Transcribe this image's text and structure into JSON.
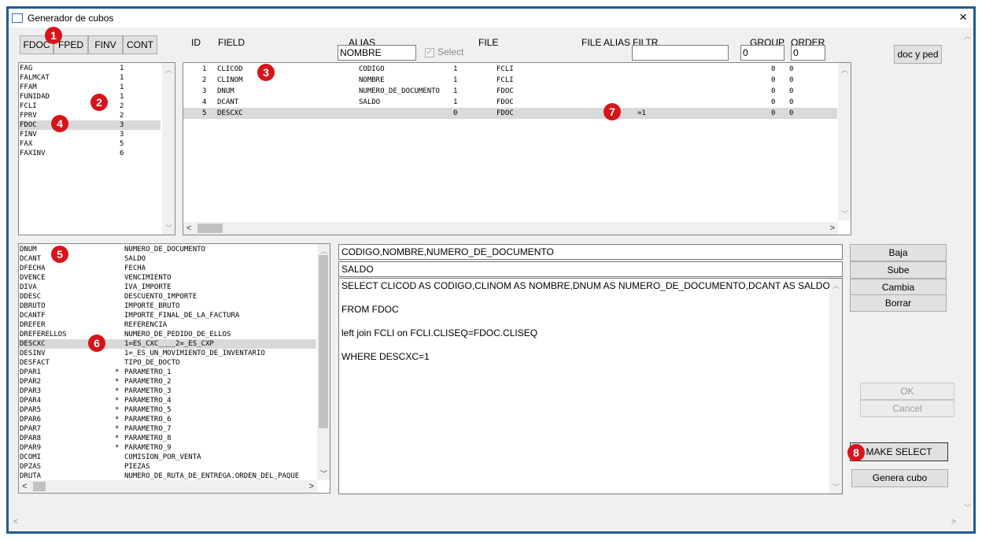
{
  "window": {
    "title": "Generador de cubos",
    "close_icon": "×"
  },
  "tabs": [
    "FDOC",
    "FPED",
    "FINV",
    "CONT"
  ],
  "headers": {
    "id": "ID",
    "field": "FIELD",
    "alias": "ALIAS",
    "file": "FILE",
    "file_alias": "FILE ALIAS",
    "filtr": "FILTR",
    "group": "GROUP",
    "order": "ORDER",
    "select_label": "Select"
  },
  "inputs": {
    "alias": "NOMBRE",
    "filtr": "",
    "group": "0",
    "order": "0"
  },
  "doc_y_ped_label": "doc y ped",
  "files_list": [
    {
      "name": "FAG",
      "count": "1"
    },
    {
      "name": "FALMCAT",
      "count": "1"
    },
    {
      "name": "FFAM",
      "count": "1"
    },
    {
      "name": "FUNIDAD",
      "count": "1"
    },
    {
      "name": "FCLI",
      "count": "2"
    },
    {
      "name": "FPRV",
      "count": "2"
    },
    {
      "name": "FDOC",
      "count": "3"
    },
    {
      "name": "FINV",
      "count": "3"
    },
    {
      "name": "FAX",
      "count": "5"
    },
    {
      "name": "FAXINV",
      "count": "6"
    }
  ],
  "grid_rows": [
    {
      "id": "1",
      "field": "CLICOD",
      "alias": "CODIGO",
      "n": "1",
      "file": "FCLI",
      "filtr": "",
      "group": "0",
      "order": "0"
    },
    {
      "id": "2",
      "field": "CLINOM",
      "alias": "NOMBRE",
      "n": "1",
      "file": "FCLI",
      "filtr": "",
      "group": "0",
      "order": "0"
    },
    {
      "id": "3",
      "field": "DNUM",
      "alias": "NUMERO_DE_DOCUMENTO",
      "n": "1",
      "file": "FDOC",
      "filtr": "",
      "group": "0",
      "order": "0"
    },
    {
      "id": "4",
      "field": "DCANT",
      "alias": "SALDO",
      "n": "1",
      "file": "FDOC",
      "filtr": "",
      "group": "0",
      "order": "0"
    },
    {
      "id": "5",
      "field": "DESCXC",
      "alias": "",
      "n": "0",
      "file": "FDOC",
      "filtr": "=1",
      "group": "0",
      "order": "0"
    }
  ],
  "fields_list": [
    {
      "name": "DNUM",
      "star": "",
      "desc": "NUMERO_DE_DOCUMENTO"
    },
    {
      "name": "DCANT",
      "star": "",
      "desc": "SALDO"
    },
    {
      "name": "DFECHA",
      "star": "",
      "desc": "FECHA"
    },
    {
      "name": "DVENCE",
      "star": "",
      "desc": "VENCIMIENTO"
    },
    {
      "name": "DIVA",
      "star": "",
      "desc": "IVA_IMPORTE"
    },
    {
      "name": "DDESC",
      "star": "",
      "desc": "DESCUENTO_IMPORTE"
    },
    {
      "name": "DBRUTO",
      "star": "",
      "desc": "IMPORTE_BRUTO"
    },
    {
      "name": "DCANTF",
      "star": "",
      "desc": "IMPORTE_FINAL_DE_LA_FACTURA"
    },
    {
      "name": "DREFER",
      "star": "",
      "desc": "REFERENCIA"
    },
    {
      "name": "DREFERELLOS",
      "star": "",
      "desc": "NUMERO_DE_PEDIDO_DE_ELLOS"
    },
    {
      "name": "DESCXC",
      "star": "",
      "desc": "1=ES_CXC____2=_ES_CXP"
    },
    {
      "name": "DESINV",
      "star": "",
      "desc": "1=_ES_UN_MOVIMIENTO_DE_INVENTARIO"
    },
    {
      "name": "DESFACT",
      "star": "",
      "desc": "TIPO_DE_DOCTO"
    },
    {
      "name": "DPAR1",
      "star": "*",
      "desc": "PARAMETRO_1"
    },
    {
      "name": "DPAR2",
      "star": "*",
      "desc": "PARAMETRO_2"
    },
    {
      "name": "DPAR3",
      "star": "*",
      "desc": "PARAMETRO_3"
    },
    {
      "name": "DPAR4",
      "star": "*",
      "desc": "PARAMETRO_4"
    },
    {
      "name": "DPAR5",
      "star": "*",
      "desc": "PARAMETRO_5"
    },
    {
      "name": "DPAR6",
      "star": "*",
      "desc": "PARAMETRO_6"
    },
    {
      "name": "DPAR7",
      "star": "*",
      "desc": "PARAMETRO_7"
    },
    {
      "name": "DPAR8",
      "star": "*",
      "desc": "PARAMETRO_8"
    },
    {
      "name": "DPAR9",
      "star": "*",
      "desc": "PARAMETRO_9"
    },
    {
      "name": "DCOMI",
      "star": "",
      "desc": "COMISION_POR_VENTA"
    },
    {
      "name": "DPZAS",
      "star": "",
      "desc": "PIEZAS"
    },
    {
      "name": "DRUTA",
      "star": "",
      "desc": "NUMERO_DE_RUTA_DE_ENTREGA.ORDEN_DEL_PAQUE"
    }
  ],
  "text_select_fields": "CODIGO,NOMBRE,NUMERO_DE_DOCUMENTO",
  "text_saldo": "SALDO",
  "sql_lines": [
    "SELECT CLICOD AS CODIGO,CLINOM AS NOMBRE,DNUM AS NUMERO_DE_DOCUMENTO,DCANT AS SALDO",
    "FROM FDOC",
    "left join FCLI on FCLI.CLISEQ=FDOC.CLISEQ",
    "WHERE DESCXC=1"
  ],
  "buttons": {
    "baja": "Baja",
    "sube": "Sube",
    "cambia": "Cambia",
    "borrar": "Borrar",
    "ok": "OK",
    "cancel": "Cancel",
    "make_select": "MAKE SELECT",
    "genera_cubo": "Genera cubo"
  },
  "badges": [
    "1",
    "2",
    "3",
    "4",
    "5",
    "6",
    "7",
    "8"
  ]
}
